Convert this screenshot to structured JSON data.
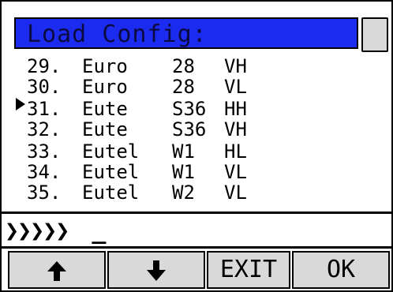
{
  "title": "Load Config:",
  "rows": [
    {
      "num": "29.",
      "sat": "Euro",
      "pos": "28",
      "pol": "VH",
      "selected": false
    },
    {
      "num": "30.",
      "sat": "Euro",
      "pos": "28",
      "pol": "VL",
      "selected": false
    },
    {
      "num": "31.",
      "sat": "Eute",
      "pos": "S36",
      "pol": "HH",
      "selected": true
    },
    {
      "num": "32.",
      "sat": "Eute",
      "pos": "S36",
      "pol": "VH",
      "selected": false
    },
    {
      "num": "33.",
      "sat": "Eutel",
      "pos": "W1",
      "pol": "HL",
      "selected": false
    },
    {
      "num": "34.",
      "sat": "Eutel",
      "pos": "W1",
      "pol": "VL",
      "selected": false
    },
    {
      "num": "35.",
      "sat": "Eutel",
      "pos": "W2",
      "pol": "VL",
      "selected": false
    }
  ],
  "input": {
    "prompt": "❯❯❯❯❯",
    "value": "_"
  },
  "buttons": {
    "up_icon": "arrow-up-icon",
    "down_icon": "arrow-down-icon",
    "exit": "EXIT",
    "ok": "OK"
  },
  "colors": {
    "title_bg": "#1c2bf0",
    "title_text": "#0b0b40",
    "button_bg": "#d9d9d9"
  }
}
